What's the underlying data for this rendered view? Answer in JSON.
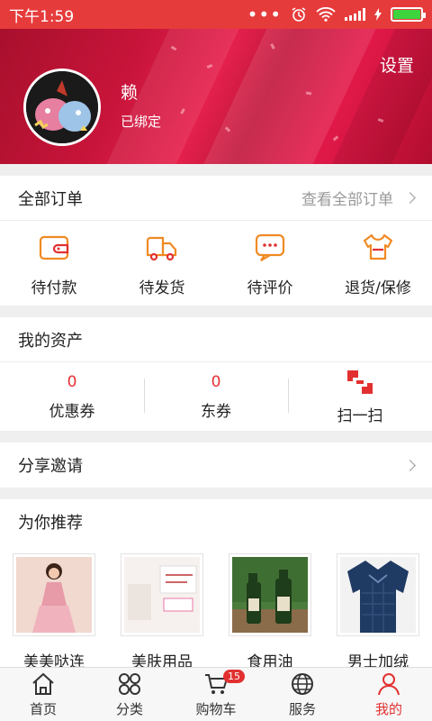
{
  "status_bar": {
    "time": "下午1:59",
    "icons": [
      "more-dots-icon",
      "alarm-icon",
      "wifi-icon",
      "signal-icon",
      "charging-icon",
      "battery-icon"
    ]
  },
  "header": {
    "settings_label": "设置",
    "username": "赖",
    "bind_status": "已绑定"
  },
  "orders": {
    "title": "全部订单",
    "view_all": "查看全部订单",
    "items": [
      {
        "label": "待付款",
        "icon": "wallet-icon"
      },
      {
        "label": "待发货",
        "icon": "truck-icon"
      },
      {
        "label": "待评价",
        "icon": "comment-icon"
      },
      {
        "label": "退货/保修",
        "icon": "return-shirt-icon"
      }
    ]
  },
  "assets": {
    "title": "我的资产",
    "items": [
      {
        "value": "0",
        "label": "优惠券"
      },
      {
        "value": "0",
        "label": "东券"
      },
      {
        "label": "扫一扫",
        "icon": "scan-icon"
      }
    ]
  },
  "share": {
    "title": "分享邀请"
  },
  "recommend": {
    "title": "为你推荐",
    "products": [
      {
        "name": "美美哒连",
        "icon": "dress-product-image"
      },
      {
        "name": "美肤用品",
        "icon": "skincare-product-image"
      },
      {
        "name": "食用油",
        "icon": "oil-product-image"
      },
      {
        "name": "男士加绒",
        "icon": "shirt-product-image"
      }
    ]
  },
  "tabbar": {
    "tabs": [
      {
        "label": "首页",
        "icon": "home-icon"
      },
      {
        "label": "分类",
        "icon": "category-icon"
      },
      {
        "label": "购物车",
        "icon": "cart-icon",
        "badge": "15"
      },
      {
        "label": "服务",
        "icon": "service-globe-icon"
      },
      {
        "label": "我的",
        "icon": "profile-icon",
        "active": true
      }
    ]
  },
  "colors": {
    "accent": "#e23030",
    "header_red": "#c8143a",
    "icon_orange": "#f08a24"
  }
}
